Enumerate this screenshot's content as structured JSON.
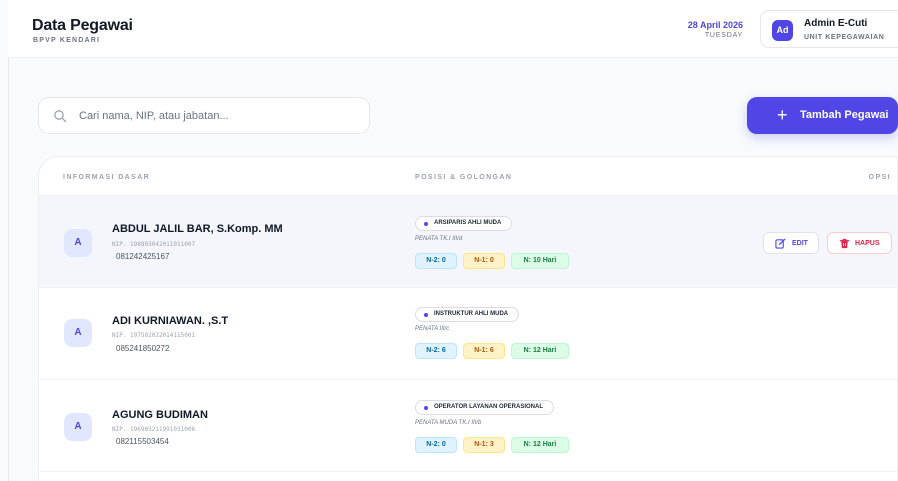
{
  "header": {
    "title": "Data Pegawai",
    "subtitle": "BPVP KENDARI",
    "date": "28 April 2026",
    "day": "TUESDAY",
    "user": {
      "initials": "Ad",
      "name": "Admin E-Cuti",
      "role": "UNIT KEPEGAWAIAN"
    }
  },
  "search": {
    "placeholder": "Cari nama, NIP, atau jabatan...",
    "value": ""
  },
  "add_button": {
    "icon": "plus-icon",
    "label": "Tambah Pegawai"
  },
  "table": {
    "headers": [
      "INFORMASI DASAR",
      "POSISI & GOLONGAN",
      "OPSI"
    ],
    "actions": {
      "edit_label": "EDIT",
      "delete_label": "HAPUS"
    },
    "rows": [
      {
        "initial": "A",
        "name": "ABDUL JALIL BAR, S.Komp. MM",
        "nip": "NIP. 198803042011011007",
        "phone": "081242425167",
        "position": "ARSIPARIS AHLI MUDA",
        "golongan": "PENATA TK.I III/d",
        "n2": "N-2: 0",
        "n1": "N-1: 0",
        "n": "N: 10 Hari",
        "highlighted": true
      },
      {
        "initial": "A",
        "name": "ADI KURNIAWAN. ,S.T",
        "nip": "NIP. 197502022014115001",
        "phone": "085241850272",
        "position": "INSTRUKTUR AHLI MUDA",
        "golongan": "PENATA III/c",
        "n2": "N-2: 6",
        "n1": "N-1: 6",
        "n": "N: 12 Hari",
        "highlighted": false
      },
      {
        "initial": "A",
        "name": "AGUNG BUDIMAN",
        "nip": "NIP. 196903211991031006",
        "phone": "082115503454",
        "position": "OPERATOR LAYANAN OPERASIONAL",
        "golongan": "PENATA MUDA TK.I III/b",
        "n2": "N-2: 0",
        "n1": "N-1: 3",
        "n": "N: 12 Hari",
        "highlighted": false
      }
    ]
  },
  "colors": {
    "accent": "#4f46e5",
    "danger": "#e11d48",
    "text": "#111827",
    "muted": "#6b7280"
  }
}
